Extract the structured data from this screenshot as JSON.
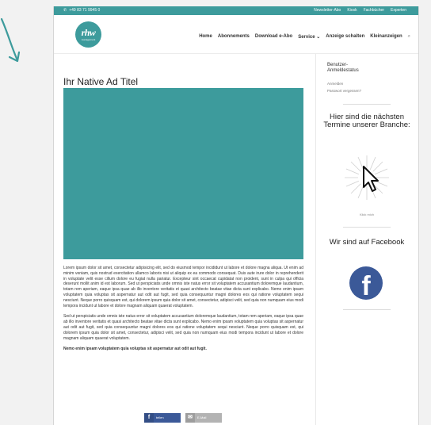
{
  "topbar": {
    "phone": "+49 83 71 9945 0",
    "links": [
      "Newsletter-Abo",
      "Kiosk",
      "Fachbücher",
      "Experten"
    ]
  },
  "logo": {
    "brand": "rhw",
    "sub": "management"
  },
  "nav": {
    "items": [
      "Home",
      "Abonnements",
      "Download e-Abo",
      "Service ⌄",
      "Anzeige schalten",
      "Kleinanzeigen"
    ]
  },
  "article": {
    "title": "Ihr Native Ad Titel",
    "paragraph_1": "Lorem ipsum dolor sit amet, consectetur adipisicing elit, sed do eiusmod tempor incididunt ut labore et dolore magna aliqua. Ut enim ad minim veniam, quis nostrud exercitation ullamco laboris nisi ut aliquip ex ea commodo consequat. Duis aute irure dolor in reprehenderit in voluptate velit esse cillum dolore eu fugiat nulla pariatur. Excepteur sint occaecat cupidatat non proident, sunt in culpa qui officia deserunt mollit anim id est laborum. Sed ut perspiciatis unde omnis iste natus error sit voluptatem accusantium doloremque laudantium, totam rem aperiam, eaque ipsa quae ab illo inventore veritatis et quasi architecto beatae vitae dicta sunt explicabo. Nemo enim ipsam voluptatem quia voluptas sit aspernatur aut odit aut fugit, sed quia consequuntur magni dolores eos qui ratione voluptatem sequi nesciunt. Neque porro quisquam est, qui dolorem ipsum quia dolor sit amet, consectetur, adipisci velit, sed quia non numquam eius modi tempora incidunt ut labore et dolore magnam aliquam quaerat voluptatem.",
    "paragraph_2": "Sed ut perspiciatis unde omnis iste natus error sit voluptatem accusantium doloremque laudantium, totam rem aperiam, eaque ipsa quae ab illo inventore veritatis et quasi architecto beatae vitae dicta sunt explicabo. Nemo enim ipsam voluptatem quia voluptas sit aspernatur aut odit aut fugit, sed quia consequuntur magni dolores eos qui ratione voluptatem sequi nesciunt. Neque porro quisquam est, qui dolorem ipsum quia dolor sit amet, consectetur, adipisci velit, sed quia non numquam eius modi tempora incidunt ut labore et dolore magnam aliquam quaerat voluptatem.",
    "paragraph_3": "Nemo enim ipsam voluptatem quia voluptas sit aspernatur aut odit aut fugit."
  },
  "share": {
    "facebook_label": "teilen",
    "email_label": "E-Mail"
  },
  "sidebar": {
    "login_title": "Benutzer-Anmeldestatus",
    "login_link": "Anmelden",
    "forgot_link": "Passwort vergessen?",
    "events_heading": "Hier sind die nächsten Termine unserer Branche:",
    "click_caption": "Klick mich",
    "social_heading": "Wir sind auf Facebook",
    "facebook_glyph": "f"
  },
  "colors": {
    "teal": "#3d9b9c",
    "facebook": "#3b5998"
  }
}
